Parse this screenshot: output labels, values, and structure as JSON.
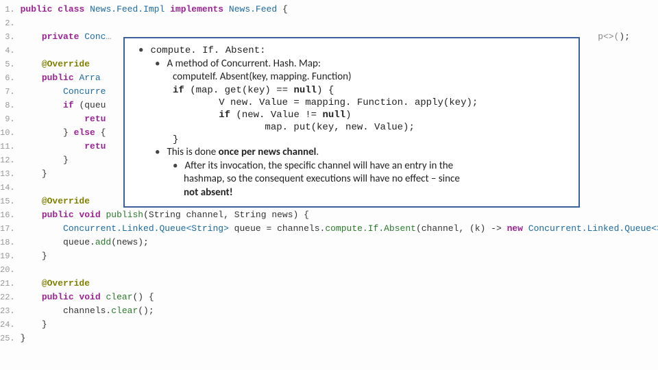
{
  "code": {
    "lines": [
      {
        "n": 1,
        "indent": 0,
        "html": "<span class='kw'>public</span> <span class='kw'>class</span> <span class='type2'>News.Feed.Impl</span> <span class='kw'>implements</span> <span class='type2'>News.Feed</span> {"
      },
      {
        "n": 2,
        "indent": 0,
        "html": ""
      },
      {
        "n": 3,
        "indent": 1,
        "html": "<span class='kw'>private</span> <span class='type2'>Conc</span><span class='gray'>…</span>                                                                                           <span class='gray'>p&lt;&gt;(</span>);"
      },
      {
        "n": 4,
        "indent": 0,
        "html": ""
      },
      {
        "n": 5,
        "indent": 1,
        "html": "<span class='ann'>@Override</span>"
      },
      {
        "n": 6,
        "indent": 1,
        "html": "<span class='kw'>public</span> <span class='type2'>Arra</span>"
      },
      {
        "n": 7,
        "indent": 2,
        "html": "<span class='type2'>Concurre</span>"
      },
      {
        "n": 8,
        "indent": 2,
        "html": "<span class='kw'>if</span> (queu"
      },
      {
        "n": 9,
        "indent": 3,
        "html": "<span class='kw'>retu</span>"
      },
      {
        "n": 10,
        "indent": 2,
        "html": "} <span class='kw'>else</span> {"
      },
      {
        "n": 11,
        "indent": 3,
        "html": "<span class='kw'>retu</span>"
      },
      {
        "n": 12,
        "indent": 2,
        "html": "}"
      },
      {
        "n": 13,
        "indent": 1,
        "html": "}"
      },
      {
        "n": 14,
        "indent": 0,
        "html": ""
      },
      {
        "n": 15,
        "indent": 1,
        "html": "<span class='ann'>@Override</span>"
      },
      {
        "n": 16,
        "indent": 1,
        "html": "<span class='kw'>public</span> <span class='kw'>void</span> <span class='fn'>publish</span>(String channel, String news) {"
      },
      {
        "n": 17,
        "indent": 2,
        "html": "<span class='type2'>Concurrent.Linked.Queue&lt;String&gt;</span> queue = channels.<span class='fn'>compute.If.Absent</span>(channel, (k) -&gt; <span class='kw'>new</span> <span class='type2'>Concurrent.Linked.Queue&lt;&gt;</span>());"
      },
      {
        "n": 18,
        "indent": 2,
        "html": "queue.<span class='fn'>add</span>(news);"
      },
      {
        "n": 19,
        "indent": 1,
        "html": "}"
      },
      {
        "n": 20,
        "indent": 0,
        "html": ""
      },
      {
        "n": 21,
        "indent": 1,
        "html": "<span class='ann'>@Override</span>"
      },
      {
        "n": 22,
        "indent": 1,
        "html": "<span class='kw'>public</span> <span class='kw'>void</span> <span class='fn'>clear</span>() {"
      },
      {
        "n": 23,
        "indent": 2,
        "html": "channels.<span class='fn'>clear</span>();"
      },
      {
        "n": 24,
        "indent": 1,
        "html": "}"
      },
      {
        "n": 25,
        "indent": 0,
        "html": "}"
      }
    ]
  },
  "callout": {
    "title_mono": "compute. If. Absent:",
    "sub1": "A method of Concurrent. Hash. Map:",
    "sig": "computeIf. Absent(key, mapping. Function)",
    "c1": "if (map. get(key) == null) {",
    "c2": "        V new. Value = mapping. Function. apply(key);",
    "c3": "        if (new. Value != null)",
    "c4": "                map. put(key, new. Value);",
    "c5": "}",
    "note1_prefix": "This is done ",
    "note1_strong": "once per news channel",
    "note1_suffix": ".",
    "note2a": "After its invocation, the specific channel will have an entry in the",
    "note2b": "hashmap, so the consequent executions will have no effect – since",
    "note2c_strong": "not absent!"
  }
}
